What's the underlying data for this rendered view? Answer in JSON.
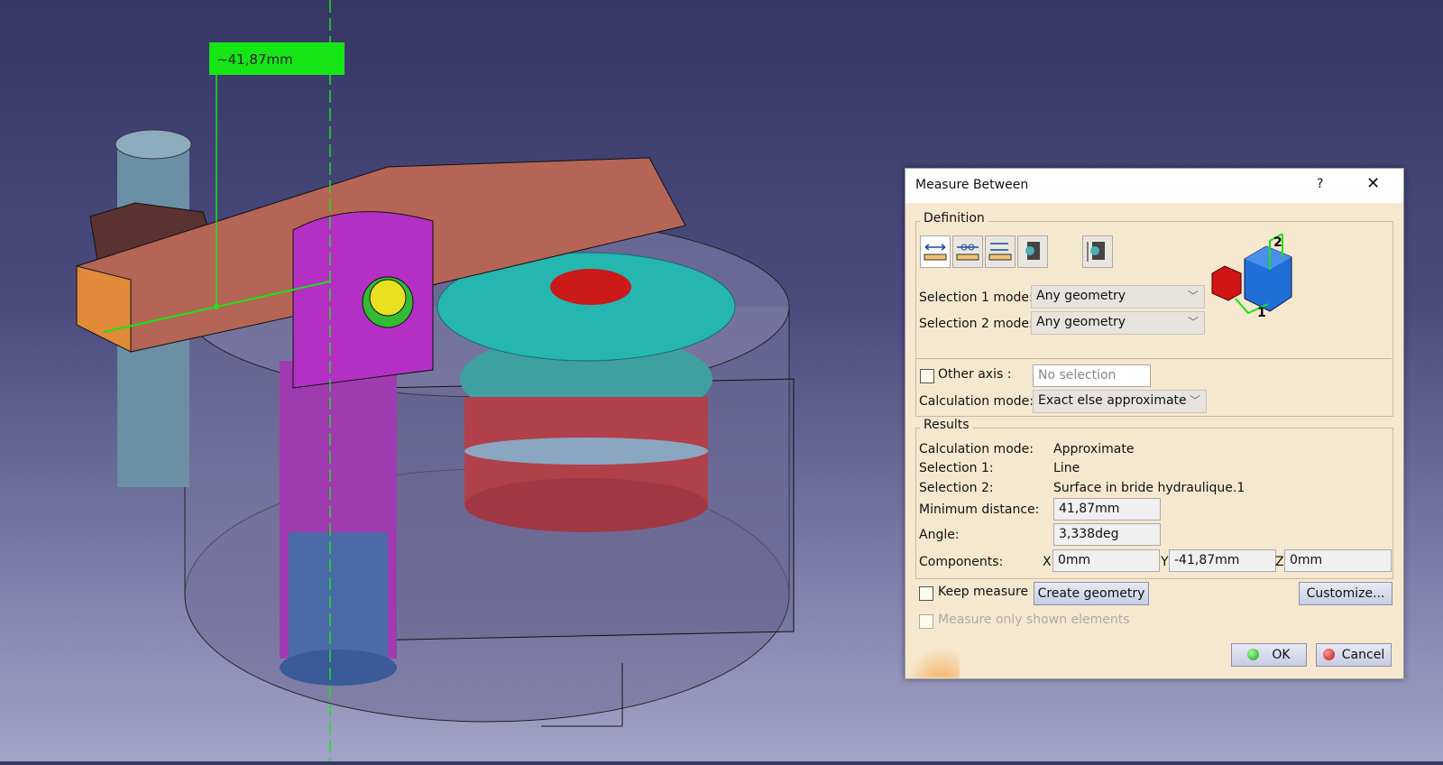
{
  "viewport": {
    "dimension_label": "~41,87mm"
  },
  "dialog": {
    "title": "Measure Between",
    "help_label": "?",
    "close_label": "✕",
    "definition": {
      "legend": "Definition",
      "toolbar": [
        "measure-between-icon",
        "measure-chain-icon",
        "measure-fan-icon",
        "measure-item-icon",
        "measure-thickness-icon"
      ],
      "selection1_label": "Selection 1 mode:",
      "selection1_value": "Any geometry",
      "selection2_label": "Selection 2 mode:",
      "selection2_value": "Any geometry",
      "other_axis_label": "Other axis :",
      "other_axis_value": "No selection",
      "calc_mode_label": "Calculation mode:",
      "calc_mode_value": "Exact else approximate",
      "illustration_labels": [
        "1",
        "2"
      ]
    },
    "results": {
      "legend": "Results",
      "calc_mode_label": "Calculation mode:",
      "calc_mode_value": "Approximate",
      "sel1_label": "Selection 1:",
      "sel1_value": "Line",
      "sel2_label": "Selection 2:",
      "sel2_value": "Surface in bride hydraulique.1",
      "min_dist_label": "Minimum distance:",
      "min_dist_value": "41,87mm",
      "angle_label": "Angle:",
      "angle_value": "3,338deg",
      "components_label": "Components:",
      "x_label": "X",
      "x_value": "0mm",
      "y_label": "Y",
      "y_value": "-41,87mm",
      "z_label": "Z",
      "z_value": "0mm"
    },
    "keep_measure_label": "Keep measure",
    "create_geometry_label": "Create geometry",
    "customize_label": "Customize...",
    "measure_only_shown_label": "Measure only shown elements",
    "ok_label": "OK",
    "cancel_label": "Cancel",
    "colors": {
      "ok": "#22aa22",
      "cancel": "#dd2222",
      "measure_line": "#16e516"
    }
  }
}
